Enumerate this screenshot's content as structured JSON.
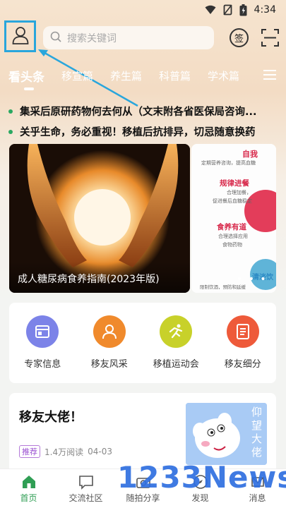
{
  "status_bar": {
    "time": "4:34"
  },
  "search": {
    "placeholder": "搜索关键词"
  },
  "header": {
    "sign_label": "签"
  },
  "tabs": [
    {
      "label": "看头条"
    },
    {
      "label": "移宣篇"
    },
    {
      "label": "养生篇"
    },
    {
      "label": "科普篇"
    },
    {
      "label": "学术篇"
    }
  ],
  "news": [
    {
      "text": "集采后原研药物何去何从（文末附各省医保局咨询..."
    },
    {
      "text": "关乎生命，务必重视！移植后抗排异，切忌随意换药"
    }
  ],
  "banner": {
    "caption": "成人糖尿病食养指南(2023年版)",
    "side_labels": [
      "自我",
      "定期营养咨询，提高血糖",
      "规律进餐",
      "合理加餐，",
      "促进餐后血糖稳定",
      "食养有道",
      "合理选择应用",
      "食物药物",
      "清淡饮",
      "限制饮酒，预防和延缓"
    ]
  },
  "quick_links": [
    {
      "label": "专家信息",
      "icon": "calendar-icon",
      "color": "#7c83e8"
    },
    {
      "label": "移友风采",
      "icon": "person-icon",
      "color": "#f08a2c"
    },
    {
      "label": "移植运动会",
      "icon": "runner-icon",
      "color": "#c8d12a"
    },
    {
      "label": "移友细分",
      "icon": "document-icon",
      "color": "#ee5a3a"
    }
  ],
  "article": {
    "title": "移友大佬！",
    "tag": "推荐",
    "views": "1.4万阅读",
    "date": "04-03",
    "thumb_text": "仰望大佬"
  },
  "bottom_nav": [
    {
      "label": "首页",
      "icon": "home-icon",
      "active": true
    },
    {
      "label": "交流社区",
      "icon": "chat-icon",
      "active": false
    },
    {
      "label": "随拍分享",
      "icon": "camera-icon",
      "active": false
    },
    {
      "label": "发现",
      "icon": "discover-icon",
      "active": false
    },
    {
      "label": "消息",
      "icon": "message-icon",
      "active": false
    }
  ],
  "watermark": "1233News",
  "colors": {
    "accent_green": "#2f9e54",
    "highlight_blue": "#29a6dc"
  }
}
